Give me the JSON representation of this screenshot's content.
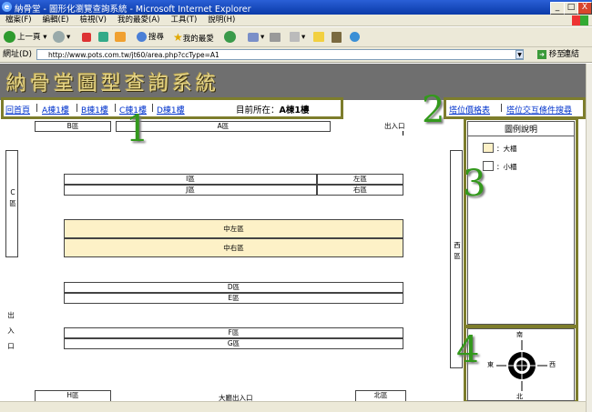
{
  "window": {
    "title": "納骨堂 - 圖形化瀏覽查詢系統 - Microsoft Internet Explorer",
    "btn_min": "_",
    "btn_max": "□",
    "btn_close": "X"
  },
  "menu": {
    "items": [
      "檔案(F)",
      "編輯(E)",
      "檢視(V)",
      "我的最愛(A)",
      "工具(T)",
      "說明(H)"
    ]
  },
  "toolbar": {
    "back": "上一頁",
    "search": "搜尋",
    "favorites": "我的最愛"
  },
  "address": {
    "label": "網址(D)",
    "url": "http://www.pots.com.tw/jt60/area.php?ccType=A1",
    "go": "移至",
    "links": "連結"
  },
  "banner": {
    "title": "納骨堂圖型查詢系統"
  },
  "nav": {
    "home": "回首頁",
    "a": "A棟1樓",
    "b": "B棟1樓",
    "c": "C棟1樓",
    "d": "D棟1樓",
    "sep": "|",
    "location_label": "目前所在：",
    "location_value": "A棟1樓",
    "price_list": "塔位價格表",
    "search": "塔位交互條件搜尋"
  },
  "callouts": [
    "1",
    "2",
    "3",
    "4"
  ],
  "map": {
    "b_zone": "B區",
    "a_zone": "A區",
    "exit_top": "出入口",
    "c_zone": "C區",
    "i_zone": "I區",
    "left_zone": "左區",
    "j_zone": "J區",
    "right_zone": "右區",
    "center_left": "中左區",
    "center_right": "中右區",
    "west_zone": "西區",
    "d_zone": "D區",
    "e_zone": "E區",
    "f_zone": "F區",
    "g_zone": "G區",
    "exit_left": [
      "出",
      "入",
      "口"
    ],
    "h_zone": "H區",
    "main_entrance": "大廳出入口",
    "north_zone": "北區"
  },
  "legend": {
    "title": "圖例說明",
    "large": "：大櫃",
    "small": "：小櫃",
    "large_color": "#fdf1c7",
    "small_color": "#ffffff"
  },
  "compass": {
    "south": "南",
    "north": "北",
    "east": "東",
    "west": "西"
  }
}
